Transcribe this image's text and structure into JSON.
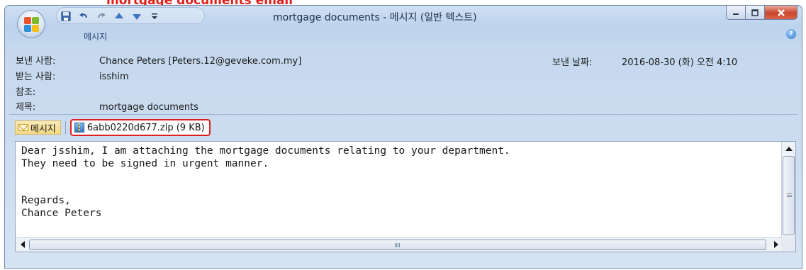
{
  "banner": {
    "text": "mortgage documents email"
  },
  "window": {
    "title": "mortgage documents - 메시지 (일반 텍스트)",
    "tab_label": "메시지",
    "help_glyph": "?"
  },
  "header": {
    "from_label": "보낸 사람:",
    "from_value": "Chance Peters [Peters.12@geveke.com.my]",
    "to_label": "받는 사람:",
    "to_value": "isshim",
    "cc_label": "참조:",
    "cc_value": "",
    "subject_label": "제목:",
    "subject_value": "mortgage documents",
    "sent_label": "보낸 날짜:",
    "sent_value": "2016-08-30 (화) 오전 4:10"
  },
  "attachments": {
    "message_label": "메시지",
    "file_label": "6abb0220d677.zip (9 KB)"
  },
  "body": {
    "text": "Dear jsshim, I am attaching the mortgage documents relating to your department.\nThey need to be signed in urgent manner.\n\n\nRegards,\nChance Peters"
  },
  "icons": {
    "office_button": "office-logo-icon",
    "save": "save-icon",
    "undo": "undo-icon",
    "redo": "redo-icon",
    "up": "previous-item-icon",
    "down": "next-item-icon",
    "customize": "customize-qat-icon",
    "envelope": "envelope-icon",
    "zip": "zip-file-icon",
    "help": "help-icon"
  },
  "colors": {
    "highlight_border": "#e02020",
    "window_chrome": "#c5d8ee",
    "close_button": "#c9452b"
  }
}
